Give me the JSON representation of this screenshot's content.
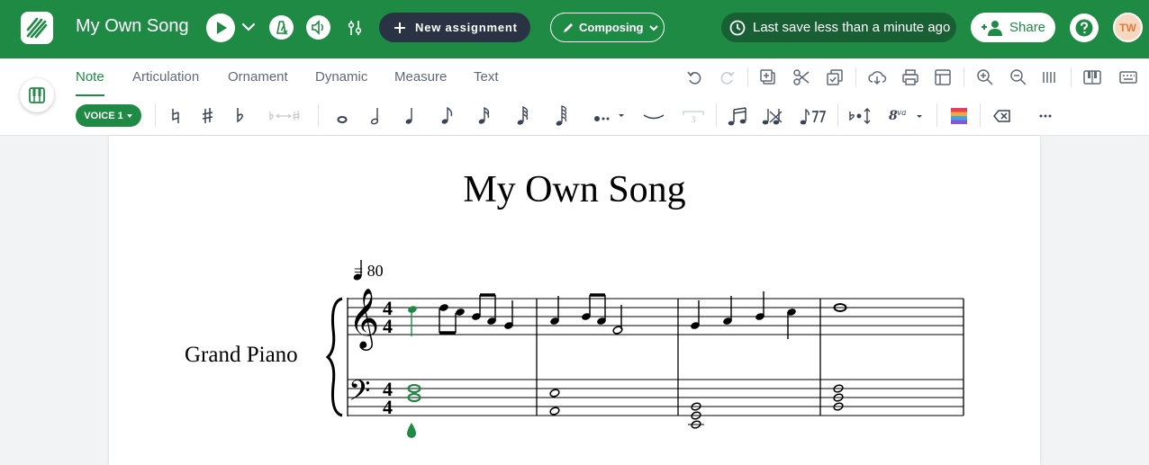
{
  "app": {
    "song_title": "My Own Song",
    "new_assignment_label": "New assignment",
    "mode_label": "Composing",
    "save_status": "Last save less than a minute ago",
    "share_label": "Share",
    "avatar_initials": "TW",
    "brand_color": "#1e8a44"
  },
  "tabs": [
    {
      "label": "Note",
      "active": true
    },
    {
      "label": "Articulation"
    },
    {
      "label": "Ornament"
    },
    {
      "label": "Dynamic"
    },
    {
      "label": "Measure"
    },
    {
      "label": "Text"
    }
  ],
  "voice_label": "VOICE 1",
  "score": {
    "title": "My Own Song",
    "tempo": "= 80",
    "instrument": "Grand Piano",
    "time_signature": "4/4"
  }
}
